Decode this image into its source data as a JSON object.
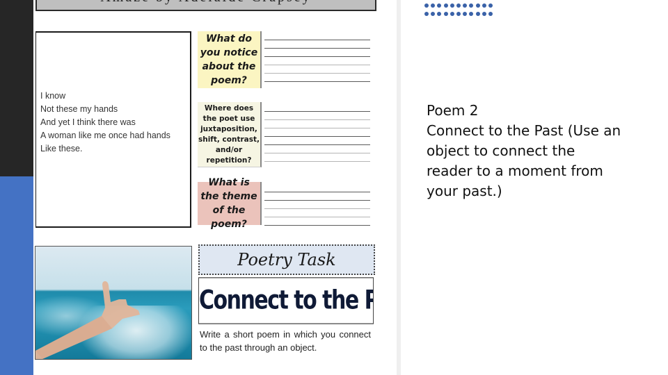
{
  "worksheet": {
    "title_banner": "Amaze  by  Adelaide  Crapsey",
    "poem_lines": [
      "I know",
      "Not these my hands",
      "And yet I think there was",
      "A woman like me once had hands",
      "Like these."
    ],
    "questions": [
      "What do you notice about the poem?",
      "Where does the poet use juxtaposition, shift, contrast, and/or repetition?",
      "What is the theme of the poem?"
    ],
    "task_banner": "Poetry Task",
    "task_title": "Connect to the Past",
    "task_description": "Write a short poem in which you connect to the past through an object.",
    "photo_description": "hand making shaka sign over ocean wake"
  },
  "slide": {
    "lines": [
      "Poem 2",
      "Connect to the Past (Use an",
      "object to connect the",
      "reader to a moment from",
      "your past.)"
    ],
    "accent_color": "#4472c4",
    "dark_bar_color": "#262626",
    "dot_color": "#3a62a8"
  }
}
